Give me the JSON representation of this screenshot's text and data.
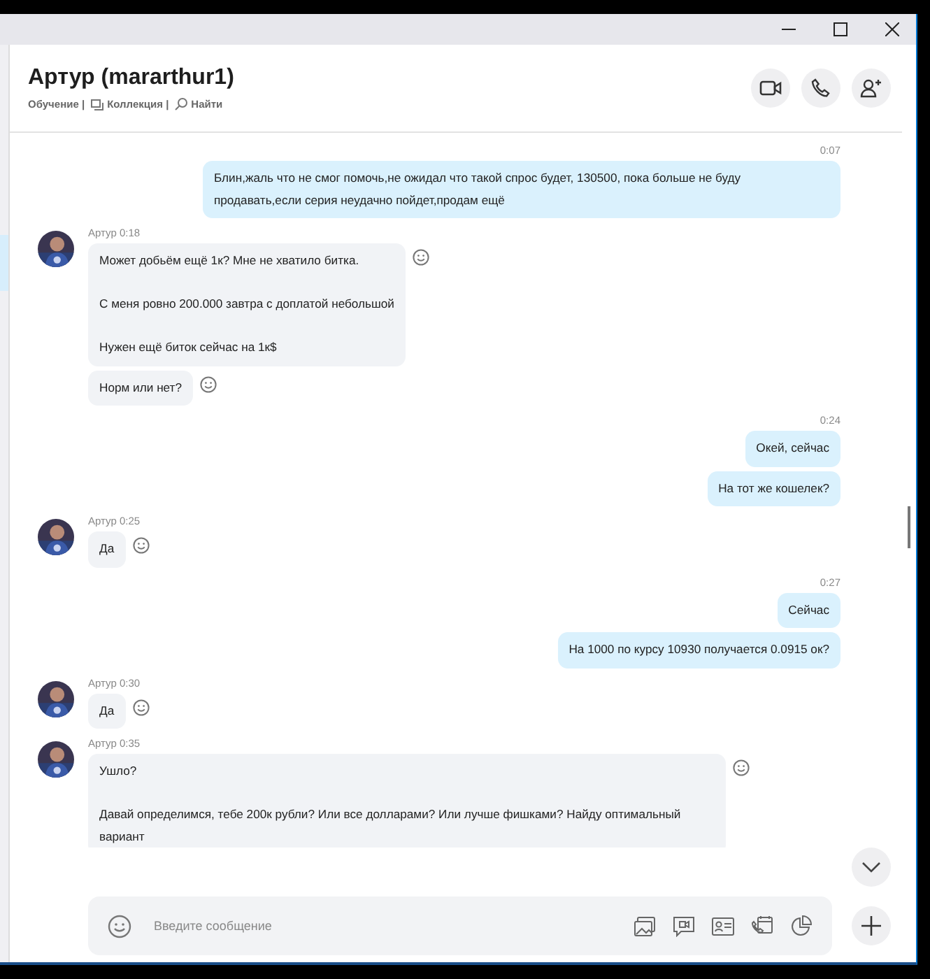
{
  "header": {
    "title": "Артур (mararthur1)",
    "links": [
      "Обучение |",
      "Коллекция |",
      "Найти"
    ]
  },
  "messages": [
    {
      "kind": "out",
      "time": "0:07",
      "bubbles": [
        "Блин,жаль что не смог помочь,не ожидал что такой спрос будет, 130500, пока больше не буду продавать,если серия неудачно пойдет,продам ещё"
      ]
    },
    {
      "kind": "in",
      "author": "Артур 0:18",
      "bubbles": [
        "Может добьём ещё 1к? Мне не хватило битка.\n\nС меня ровно 200.000 завтра с доплатой небольшой\n\nНужен ещё биток сейчас на 1к$",
        "Норм или нет?"
      ]
    },
    {
      "kind": "out",
      "time": "0:24",
      "bubbles": [
        "Окей, сейчас",
        "На тот же кошелек?"
      ]
    },
    {
      "kind": "in",
      "author": "Артур 0:25",
      "bubbles": [
        "Да"
      ]
    },
    {
      "kind": "out",
      "time": "0:27",
      "bubbles": [
        "Сейчас",
        "На 1000 по курсу 10930 получается 0.0915 ок?"
      ]
    },
    {
      "kind": "in",
      "author": "Артур 0:30",
      "bubbles": [
        "Да"
      ]
    },
    {
      "kind": "in",
      "author": "Артур 0:35",
      "bubbles": [
        "Ушло?\n\nДавай определимся, тебе 200к рубли? Или все долларами? Или лучше фишками? Найду оптимальный вариант"
      ]
    }
  ],
  "composer": {
    "placeholder": "Введите сообщение"
  }
}
